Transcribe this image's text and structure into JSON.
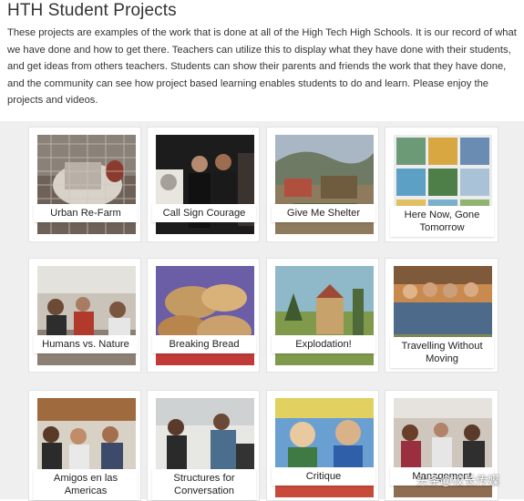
{
  "header": {
    "title": "HTH Student Projects",
    "intro": "These projects are examples of the work that is done at all of the High Tech High Schools. It is our record of what we have done and how to get there. Teachers can utilize this to display what they have done with their students, and get ideas from others teachers. Students can show their parents and friends the work that they have done, and the community can see how project based learning enables students to do and learn. Please enjoy the projects and videos."
  },
  "projects": [
    {
      "label": "Urban Re-Farm",
      "image": "chicken-in-cage"
    },
    {
      "label": "Call Sign Courage",
      "image": "students-with-portrait"
    },
    {
      "label": "Give Me Shelter",
      "image": "outdoor-shelter-model"
    },
    {
      "label": "Here Now, Gone Tomorrow",
      "image": "animal-paintings-grid"
    },
    {
      "label": "Humans vs. Nature",
      "image": "students-in-lab"
    },
    {
      "label": "Breaking Bread",
      "image": "bread-loaves"
    },
    {
      "label": "Explodation!",
      "image": "landscape-painting"
    },
    {
      "label": "Travelling Without Moving",
      "image": "group-painting"
    },
    {
      "label": "Amigos en las Americas",
      "image": "students-in-classroom"
    },
    {
      "label": "Structures for Conversation",
      "image": "students-presenting"
    },
    {
      "label": "Critique",
      "image": "cartoon-painting"
    },
    {
      "label": "Management",
      "image": "students-at-desks"
    }
  ],
  "watermark": "头条@校长传媒"
}
